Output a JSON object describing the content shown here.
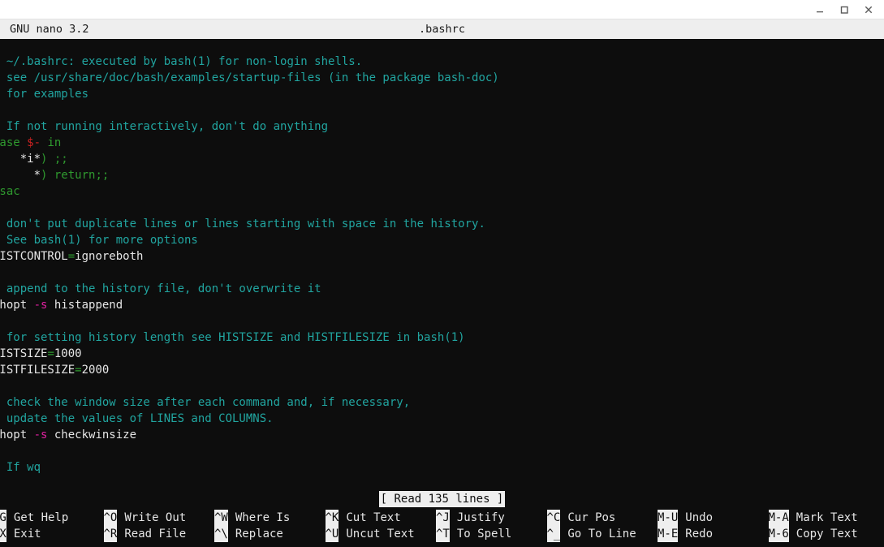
{
  "window": {
    "title": "",
    "controls": [
      {
        "name": "minimize",
        "glyph": "minimize-icon"
      },
      {
        "name": "maximize",
        "glyph": "maximize-icon"
      },
      {
        "name": "close",
        "glyph": "close-icon"
      }
    ]
  },
  "nano": {
    "version_label": "GNU nano 3.2",
    "filename": ".bashrc",
    "status_message": "[ Read 135 lines ]"
  },
  "colors": {
    "background": "#0d0d0d",
    "header_bg": "#eeeeee",
    "header_fg": "#1a1a1a",
    "comment": "#21a5a0",
    "keyword": "#2f9a2f",
    "variable": "#cc2222",
    "flag": "#e020a0",
    "plain": "#e6e6e6",
    "cursor": "#b01515"
  },
  "editor": {
    "lines": [
      {
        "id": 1,
        "tokens": [
          {
            "t": "cursor",
            "v": "#"
          },
          {
            "t": "comment",
            "v": " ~/.bashrc: executed by bash(1) for non-login shells."
          }
        ]
      },
      {
        "id": 2,
        "tokens": [
          {
            "t": "comment",
            "v": "# see /usr/share/doc/bash/examples/startup-files (in the package bash-doc)"
          }
        ]
      },
      {
        "id": 3,
        "tokens": [
          {
            "t": "comment",
            "v": "# for examples"
          }
        ]
      },
      {
        "id": 4,
        "tokens": []
      },
      {
        "id": 5,
        "tokens": [
          {
            "t": "comment",
            "v": "# If not running interactively, don't do anything"
          }
        ]
      },
      {
        "id": 6,
        "tokens": [
          {
            "t": "kw",
            "v": "case "
          },
          {
            "t": "var",
            "v": "$-"
          },
          {
            "t": "kw",
            "v": " in"
          }
        ]
      },
      {
        "id": 7,
        "tokens": [
          {
            "t": "plain",
            "v": "    *i*"
          },
          {
            "t": "punc",
            "v": ") ;;"
          }
        ]
      },
      {
        "id": 8,
        "tokens": [
          {
            "t": "plain",
            "v": "      *"
          },
          {
            "t": "punc",
            "v": ") "
          },
          {
            "t": "kw",
            "v": "return;;"
          }
        ]
      },
      {
        "id": 9,
        "tokens": [
          {
            "t": "kw",
            "v": "esac"
          }
        ]
      },
      {
        "id": 10,
        "tokens": []
      },
      {
        "id": 11,
        "tokens": [
          {
            "t": "comment",
            "v": "# don't put duplicate lines or lines starting with space in the history."
          }
        ]
      },
      {
        "id": 12,
        "tokens": [
          {
            "t": "comment",
            "v": "# See bash(1) for more options"
          }
        ]
      },
      {
        "id": 13,
        "tokens": [
          {
            "t": "plain",
            "v": "HISTCONTROL"
          },
          {
            "t": "eq",
            "v": "="
          },
          {
            "t": "plain",
            "v": "ignoreboth"
          }
        ]
      },
      {
        "id": 14,
        "tokens": []
      },
      {
        "id": 15,
        "tokens": [
          {
            "t": "comment",
            "v": "# append to the history file, don't overwrite it"
          }
        ]
      },
      {
        "id": 16,
        "tokens": [
          {
            "t": "plain",
            "v": "shopt "
          },
          {
            "t": "flag",
            "v": "-s"
          },
          {
            "t": "plain",
            "v": " histappend"
          }
        ]
      },
      {
        "id": 17,
        "tokens": []
      },
      {
        "id": 18,
        "tokens": [
          {
            "t": "comment",
            "v": "# for setting history length see HISTSIZE and HISTFILESIZE in bash(1)"
          }
        ]
      },
      {
        "id": 19,
        "tokens": [
          {
            "t": "plain",
            "v": "HISTSIZE"
          },
          {
            "t": "eq",
            "v": "="
          },
          {
            "t": "plain",
            "v": "1000"
          }
        ]
      },
      {
        "id": 20,
        "tokens": [
          {
            "t": "plain",
            "v": "HISTFILESIZE"
          },
          {
            "t": "eq",
            "v": "="
          },
          {
            "t": "plain",
            "v": "2000"
          }
        ]
      },
      {
        "id": 21,
        "tokens": []
      },
      {
        "id": 22,
        "tokens": [
          {
            "t": "comment",
            "v": "# check the window size after each command and, if necessary,"
          }
        ]
      },
      {
        "id": 23,
        "tokens": [
          {
            "t": "comment",
            "v": "# update the values of LINES and COLUMNS."
          }
        ]
      },
      {
        "id": 24,
        "tokens": [
          {
            "t": "plain",
            "v": "shopt "
          },
          {
            "t": "flag",
            "v": "-s"
          },
          {
            "t": "plain",
            "v": " checkwinsize"
          }
        ]
      },
      {
        "id": 25,
        "tokens": []
      },
      {
        "id": 26,
        "tokens": [
          {
            "t": "comment",
            "v": "# If wq"
          }
        ]
      }
    ]
  },
  "helpbar": {
    "row1": [
      {
        "key": "^G",
        "label": "Get Help"
      },
      {
        "key": "^O",
        "label": "Write Out"
      },
      {
        "key": "^W",
        "label": "Where Is"
      },
      {
        "key": "^K",
        "label": "Cut Text"
      },
      {
        "key": "^J",
        "label": "Justify"
      },
      {
        "key": "^C",
        "label": "Cur Pos"
      },
      {
        "key": "M-U",
        "label": "Undo"
      },
      {
        "key": "M-A",
        "label": "Mark Text"
      }
    ],
    "row2": [
      {
        "key": "^X",
        "label": "Exit"
      },
      {
        "key": "^R",
        "label": "Read File"
      },
      {
        "key": "^\\",
        "label": "Replace"
      },
      {
        "key": "^U",
        "label": "Uncut Text"
      },
      {
        "key": "^T",
        "label": "To Spell"
      },
      {
        "key": "^_",
        "label": "Go To Line"
      },
      {
        "key": "M-E",
        "label": "Redo"
      },
      {
        "key": "M-6",
        "label": "Copy Text"
      }
    ]
  }
}
